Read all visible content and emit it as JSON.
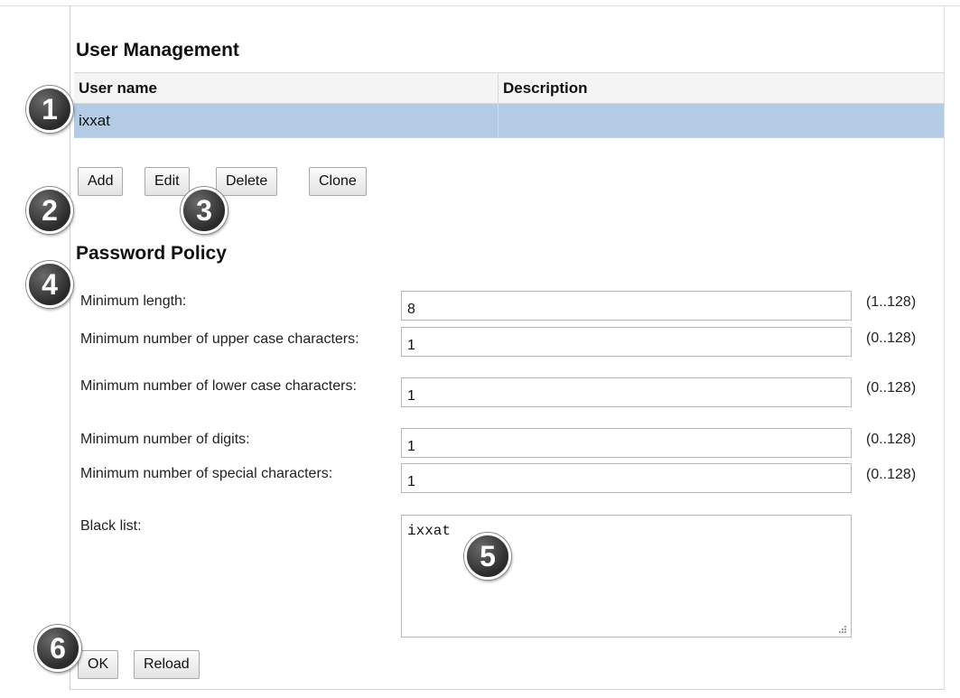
{
  "user_management": {
    "title": "User Management",
    "columns": [
      "User name",
      "Description"
    ],
    "rows": [
      {
        "user_name": "ixxat",
        "description": ""
      }
    ],
    "buttons": {
      "add": "Add",
      "edit": "Edit",
      "delete": "Delete",
      "clone": "Clone"
    }
  },
  "password_policy": {
    "title": "Password Policy",
    "fields": [
      {
        "label": "Minimum length:",
        "value": "8",
        "range": "(1..128)"
      },
      {
        "label": "Minimum number of upper case characters:",
        "value": "1",
        "range": "(0..128)"
      },
      {
        "label": "Minimum number of lower case characters:",
        "value": "1",
        "range": "(0..128)"
      },
      {
        "label": "Minimum number of digits:",
        "value": "1",
        "range": "(0..128)"
      },
      {
        "label": "Minimum number of special characters:",
        "value": "1",
        "range": "(0..128)"
      }
    ],
    "black_list": {
      "label": "Black list:",
      "value": "ixxat"
    }
  },
  "footer_buttons": {
    "ok": "OK",
    "reload": "Reload"
  },
  "callouts": [
    "1",
    "2",
    "3",
    "4",
    "5",
    "6"
  ]
}
